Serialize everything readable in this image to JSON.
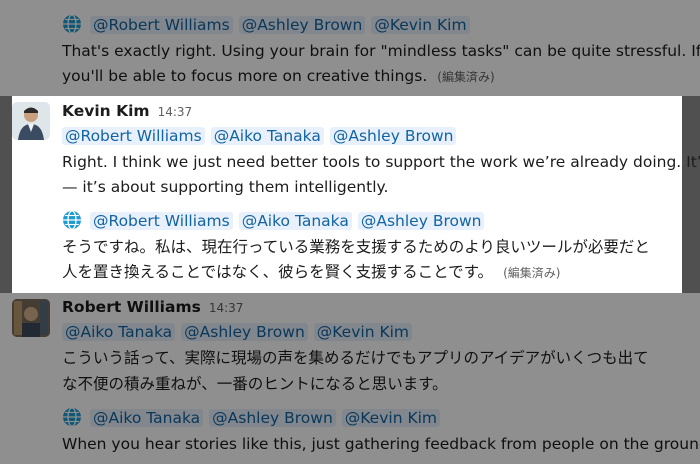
{
  "top_message": {
    "mentions": [
      "@Robert Williams",
      "@Ashley Brown",
      "@Kevin Kim"
    ],
    "text_line1": "That's exactly right. Using your brain for \"mindless tasks\" can be quite stressful. If you",
    "text_line2": "you'll be able to focus more on creative things.",
    "edited": "(編集済み)"
  },
  "kevin_message": {
    "author": "Kevin Kim",
    "time": "14:37",
    "mentions": [
      "@Robert Williams",
      "@Aiko Tanaka",
      "@Ashley Brown"
    ],
    "text_line1": "Right. I think we just need better tools to support the work we’re already doing. It’s no",
    "text_line2": "— it’s about supporting them intelligently.",
    "translated_mentions": [
      "@Robert Williams",
      "@Aiko Tanaka",
      "@Ashley Brown"
    ],
    "translated_line1": "そうですね。私は、現在行っている業務を支援するためのより良いツールが必要だと",
    "translated_line2": "人を置き換えることではなく、彼らを賢く支援することです。",
    "edited": "(編集済み)"
  },
  "robert_message": {
    "author": "Robert Williams",
    "time": "14:37",
    "mentions": [
      "@Aiko Tanaka",
      "@Ashley Brown",
      "@Kevin Kim"
    ],
    "text_line1": "こういう話って、実際に現場の声を集めるだけでもアプリのアイデアがいくつも出て",
    "text_line2": "な不便の積み重ねが、一番のヒントになると思います。",
    "translated_mentions": [
      "@Aiko Tanaka",
      "@Ashley Brown",
      "@Kevin Kim"
    ],
    "translated_line1": "When you hear stories like this, just gathering feedback from people on the ground se"
  },
  "colors": {
    "mention_bg": "#e8f0fb",
    "mention_text": "#1264a3",
    "globe": "#1d9bd1"
  },
  "icons": {
    "translate": "globe-icon"
  }
}
